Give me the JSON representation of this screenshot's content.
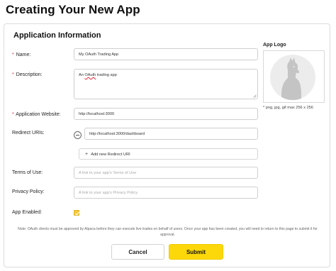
{
  "page": {
    "title": "Creating Your New App"
  },
  "form": {
    "section_title": "Application Information",
    "name": {
      "label": "Name:",
      "required": "*",
      "value": "My OAuth Trading App"
    },
    "description": {
      "label": "Description:",
      "required": "*",
      "value_prefix": "An",
      "value_spell": "OAuth",
      "value_suffix": "trading app"
    },
    "website": {
      "label": "Application Website:",
      "required": "*",
      "value": "http://localhost:3000"
    },
    "redirect_uris": {
      "label": "Redirect URIs:",
      "items": [
        "http://localhost:3000/dashboard"
      ],
      "add_label": "Add new Redirect URI",
      "add_icon": "+"
    },
    "terms": {
      "label": "Terms of Use:",
      "placeholder": "A link to your app's Terms of Use"
    },
    "privacy": {
      "label": "Privacy Policy:",
      "placeholder": "A link to your app's Privacy Policy"
    },
    "enabled": {
      "label": "App Enabled:",
      "checked": true
    }
  },
  "logo": {
    "label": "App Logo",
    "hint": "* png, jpg, gif max 256 x 256",
    "icon": "alpaca-logo-icon"
  },
  "note": "Note: OAuth clients must be approved by Alpaca before they can execute live trades on behalf of users. Once your app has been created, you will need to return to this page to submit it for approval.",
  "actions": {
    "cancel": "Cancel",
    "submit": "Submit"
  },
  "colors": {
    "accent": "#fcd80a",
    "checkbox": "#f7c93a",
    "required": "#dd3344"
  }
}
